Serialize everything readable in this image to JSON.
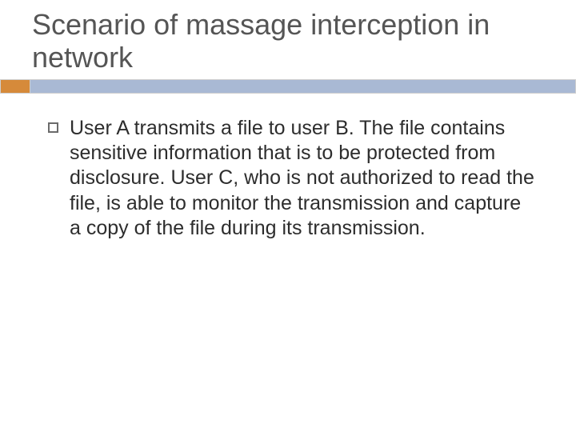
{
  "slide": {
    "title": "Scenario of massage interception in network",
    "bullets": [
      {
        "text": "User A transmits a file to user B. The file contains sensitive information that is to be protected from disclosure. User C, who is not authorized to read the file, is able to monitor the transmission and capture a copy of the file during its transmission."
      }
    ],
    "accent_colors": {
      "orange": "#d68a3a",
      "blue": "#a9b9d4"
    }
  }
}
